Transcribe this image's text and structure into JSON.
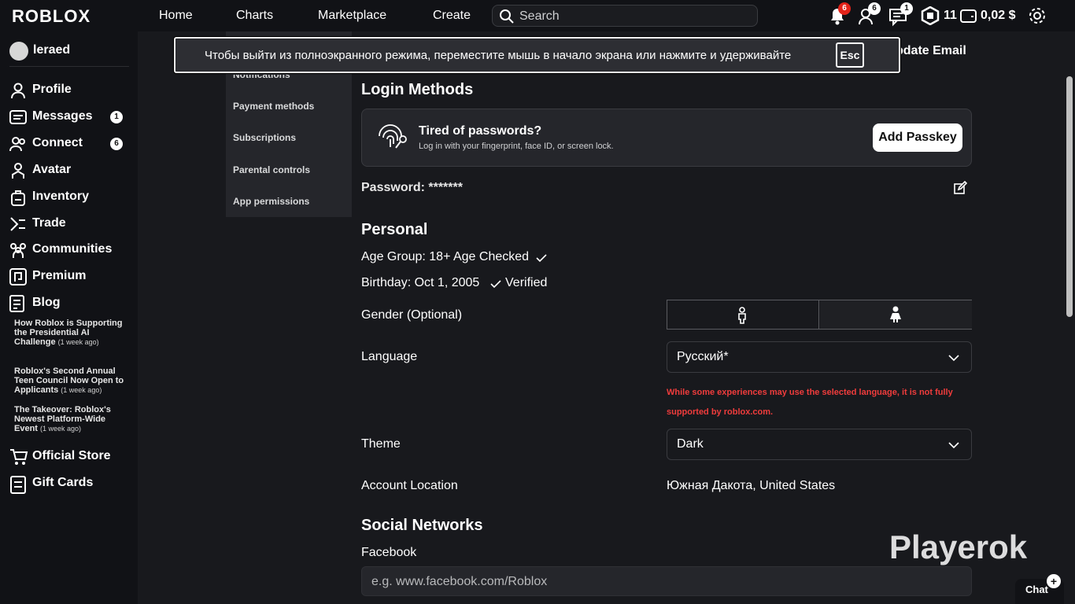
{
  "topbar": {
    "logo": "ROBLOX",
    "nav": [
      "Home",
      "Charts",
      "Marketplace",
      "Create"
    ],
    "search_placeholder": "Search",
    "notifications_badge": "6",
    "friends_badge": "6",
    "messages_badge": "1",
    "robux": "11",
    "balance": "0,02 $"
  },
  "sidebar": {
    "username": "leraed",
    "items": [
      {
        "label": "Profile",
        "icon": "profile-icon"
      },
      {
        "label": "Messages",
        "icon": "messages-icon",
        "count": "1"
      },
      {
        "label": "Connect",
        "icon": "connect-icon",
        "count": "6"
      },
      {
        "label": "Avatar",
        "icon": "avatar-icon"
      },
      {
        "label": "Inventory",
        "icon": "inventory-icon"
      },
      {
        "label": "Trade",
        "icon": "trade-icon"
      },
      {
        "label": "Communities",
        "icon": "communities-icon"
      },
      {
        "label": "Premium",
        "icon": "premium-icon"
      },
      {
        "label": "Blog",
        "icon": "blog-icon"
      }
    ],
    "blog_posts": [
      {
        "title": "How Roblox is Supporting the Presidential AI Challenge",
        "ago": "(1 week ago)"
      },
      {
        "title": "Roblox's Second Annual Teen Council Now Open to Applicants",
        "ago": "(1 week ago)"
      },
      {
        "title": "The Takeover: Roblox's Newest Platform-Wide Event",
        "ago": "(1 week ago)"
      }
    ],
    "bottom_items": [
      {
        "label": "Official Store",
        "icon": "cart-icon"
      },
      {
        "label": "Gift Cards",
        "icon": "gift-card-icon"
      }
    ]
  },
  "settings_menu": {
    "partial_item": "Notifications",
    "items": [
      "Payment methods",
      "Subscriptions",
      "Parental controls",
      "App permissions"
    ]
  },
  "fullscreen_toast": {
    "message": "Чтобы выйти из полноэкранного режима, переместите мышь в начало экрана или нажмите и удерживайте",
    "key": "Esc"
  },
  "account": {
    "update_email": "pdate Email",
    "login_methods_title": "Login Methods",
    "passkey_title": "Tired of passwords?",
    "passkey_sub": "Log in with your fingerprint, face ID, or screen lock.",
    "passkey_button": "Add Passkey",
    "password_label": "Password: *******",
    "personal_title": "Personal",
    "age_group": "Age Group: 18+ Age Checked",
    "birthday": "Birthday: Oct 1, 2005",
    "verified": "Verified",
    "gender_label": "Gender (Optional)",
    "language_label": "Language",
    "language_value": "Русский*",
    "language_warning": "While some experiences may use the selected language, it is not fully supported by roblox.com.",
    "theme_label": "Theme",
    "theme_value": "Dark",
    "location_label": "Account Location",
    "location_value": "Южная Дакота, United States",
    "social_title": "Social Networks",
    "facebook_label": "Facebook",
    "facebook_placeholder": "e.g. www.facebook.com/Roblox"
  },
  "watermark": "Playerok",
  "chat": {
    "label": "Chat",
    "plus": "+"
  }
}
